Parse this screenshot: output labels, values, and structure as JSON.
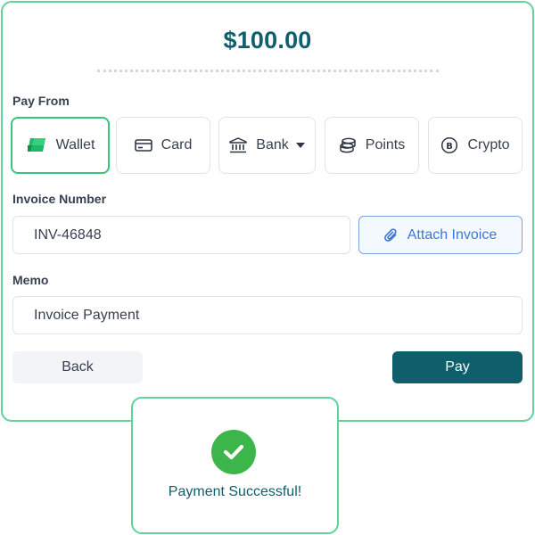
{
  "payment": {
    "amount": "$100.00"
  },
  "pay_from": {
    "label": "Pay From",
    "selected": "Wallet",
    "methods": [
      {
        "label": "Wallet",
        "icon": "wallet-icon"
      },
      {
        "label": "Card",
        "icon": "card-icon"
      },
      {
        "label": "Bank",
        "icon": "bank-icon",
        "has_dropdown": true
      },
      {
        "label": "Points",
        "icon": "coins-icon"
      },
      {
        "label": "Crypto",
        "icon": "bitcoin-icon"
      }
    ]
  },
  "invoice": {
    "label": "Invoice Number",
    "value": "INV-46848",
    "attach_label": "Attach Invoice"
  },
  "memo": {
    "label": "Memo",
    "value": "Invoice Payment"
  },
  "actions": {
    "back_label": "Back",
    "pay_label": "Pay"
  },
  "toast": {
    "message": "Payment Successful!"
  },
  "colors": {
    "accent": "#0e5f6c",
    "success_border": "#5fd39a",
    "selected_border": "#34c77b",
    "link_blue": "#3d78d8",
    "check_green": "#3cb54a"
  }
}
